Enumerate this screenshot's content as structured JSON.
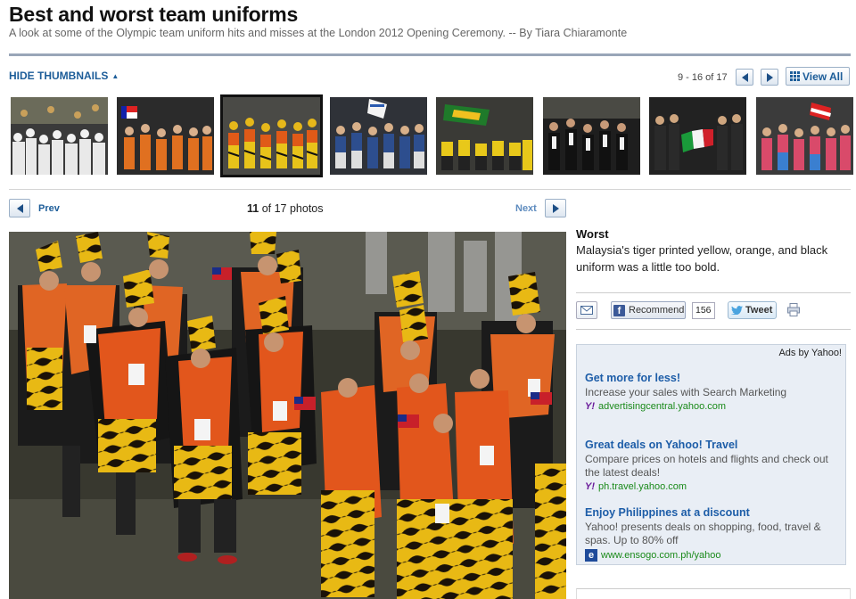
{
  "page": {
    "title": "Best and worst team uniforms",
    "subtitle": "A look at some of the Olympic team uniform hits and misses at the London 2012 Opening Ceremony. -- By Tiara Chiaramonte"
  },
  "gallery": {
    "hide_thumbnails_label": "HIDE THUMBNAILS",
    "range_text": "9 - 16 of 17",
    "view_all_label": "View All",
    "thumbnails": [
      {
        "icon": "crowd-white-photo"
      },
      {
        "icon": "flag-orange-photo"
      },
      {
        "icon": "tiger-uniform-photo",
        "selected": true
      },
      {
        "icon": "flag-blue-photo"
      },
      {
        "icon": "yellow-team-photo"
      },
      {
        "icon": "dark-team-photo"
      },
      {
        "icon": "italy-flag-photo"
      },
      {
        "icon": "flag-pink-photo"
      }
    ]
  },
  "navigation": {
    "prev_label": "Prev",
    "next_label": "Next",
    "current": "11",
    "of_text": "of 17 photos"
  },
  "caption": {
    "heading": "Worst",
    "text": "Malaysia's tiger printed yellow, orange, and black uniform was a little too bold."
  },
  "share": {
    "recommend_label": "Recommend",
    "recommend_count": "156",
    "tweet_label": "Tweet"
  },
  "ads": {
    "header": "Ads by Yahoo!",
    "items": [
      {
        "title": "Get more for less!",
        "desc": "Increase your sales with Search Marketing",
        "url": "advertisingcentral.yahoo.com",
        "icon": "yahoo-icon"
      },
      {
        "title": "Great deals on Yahoo! Travel",
        "desc": "Compare prices on hotels and flights and check out the latest deals!",
        "url": "ph.travel.yahoo.com",
        "icon": "yahoo-icon"
      },
      {
        "title": "Enjoy Philippines at a discount",
        "desc": "Yahoo! presents deals on shopping, food, travel & spas. Up to 80% off",
        "url": "www.ensogo.com.ph/yahoo",
        "icon": "ensogo-icon"
      }
    ]
  },
  "colors": {
    "link": "#1d5d99",
    "rule": "#99a6b8",
    "ad_bg": "#e9eef5"
  }
}
